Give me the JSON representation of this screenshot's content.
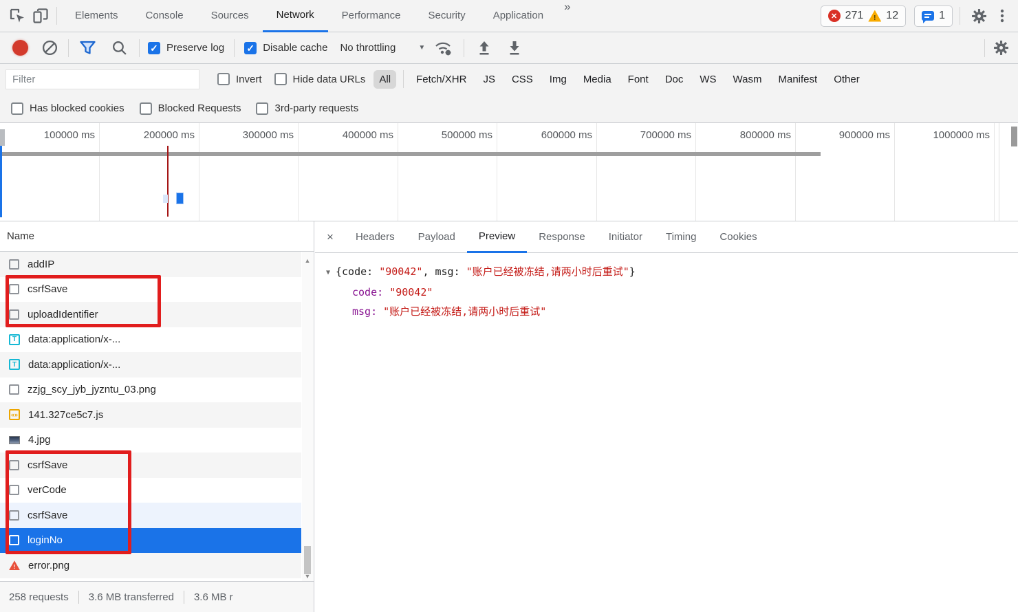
{
  "main_tabs": {
    "tabs": [
      "Elements",
      "Console",
      "Sources",
      "Network",
      "Performance",
      "Security",
      "Application"
    ],
    "active_tab": "Network",
    "overflow": "»",
    "error_count": "271",
    "warning_count": "12",
    "warning_glyph": "!",
    "error_glyph": "✕",
    "issue_count": "1"
  },
  "net_toolbar": {
    "preserve_log": "Preserve log",
    "disable_cache": "Disable cache",
    "throttling": "No throttling",
    "caret": "▼",
    "check_glyph": "✓"
  },
  "filter_row": {
    "placeholder": "Filter",
    "invert": "Invert",
    "hide_data_urls": "Hide data URLs",
    "types": [
      "All",
      "Fetch/XHR",
      "JS",
      "CSS",
      "Img",
      "Media",
      "Font",
      "Doc",
      "WS",
      "Wasm",
      "Manifest",
      "Other"
    ],
    "active_type": "All"
  },
  "options_row": {
    "has_blocked_cookies": "Has blocked cookies",
    "blocked_requests": "Blocked Requests",
    "third_party_requests": "3rd-party requests"
  },
  "timeline": {
    "ticks": [
      "100000 ms",
      "200000 ms",
      "300000 ms",
      "400000 ms",
      "500000 ms",
      "600000 ms",
      "700000 ms",
      "800000 ms",
      "900000 ms",
      "1000000 ms"
    ]
  },
  "requests_panel": {
    "name_header": "Name",
    "scroll_up": "▲",
    "scroll_down": "▼",
    "rows": [
      {
        "name": "addIP",
        "icon": "doc-icon"
      },
      {
        "name": "csrfSave",
        "icon": "doc-icon"
      },
      {
        "name": "uploadIdentifier",
        "icon": "doc-icon"
      },
      {
        "name": "data:application/x-...",
        "icon": "text-type-icon",
        "glyph": "T"
      },
      {
        "name": "data:application/x-...",
        "icon": "text-type-icon",
        "glyph": "T"
      },
      {
        "name": "zzjg_scy_jyb_jyzntu_03.png",
        "icon": "doc-icon"
      },
      {
        "name": "141.327ce5c7.js",
        "icon": "script-icon",
        "glyph": "«»"
      },
      {
        "name": "4.jpg",
        "icon": "image-thumb-icon"
      },
      {
        "name": "csrfSave",
        "icon": "doc-icon"
      },
      {
        "name": "verCode",
        "icon": "doc-icon"
      },
      {
        "name": "csrfSave",
        "icon": "doc-icon"
      },
      {
        "name": "loginNo",
        "icon": "doc-icon",
        "selected": true
      },
      {
        "name": "error.png",
        "icon": "warning-icon",
        "glyph": "!"
      }
    ]
  },
  "details_panel": {
    "close": "×",
    "tabs": [
      "Headers",
      "Payload",
      "Preview",
      "Response",
      "Initiator",
      "Timing",
      "Cookies"
    ],
    "active_tab": "Preview",
    "preview": {
      "expander": "▼",
      "summary_open": "{code: ",
      "summary_code_value": "\"90042\"",
      "summary_mid": ", msg: ",
      "summary_msg_value": "\"账户已经被冻结,请两小时后重试\"",
      "summary_close": "}",
      "code_key": "code: ",
      "code_value": "\"90042\"",
      "msg_key": "msg: ",
      "msg_value": "\"账户已经被冻结,请两小时后重试\""
    }
  },
  "status_bar": {
    "requests": "258 requests",
    "transferred": "3.6 MB transferred",
    "resources": "3.6 MB r"
  }
}
